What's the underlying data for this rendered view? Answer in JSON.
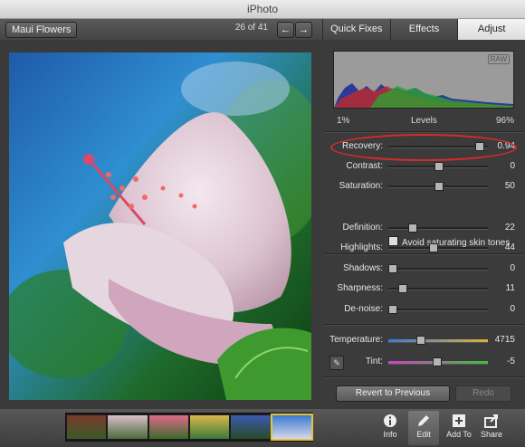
{
  "window": {
    "title": "iPhoto"
  },
  "toolbar": {
    "album_label": "Maui Flowers",
    "counter": "26 of 41",
    "prev_glyph": "←",
    "next_glyph": "→"
  },
  "tabs": [
    {
      "label": "Quick Fixes",
      "active": false
    },
    {
      "label": "Effects",
      "active": false
    },
    {
      "label": "Adjust",
      "active": true
    }
  ],
  "histogram": {
    "raw_badge": "RAW",
    "left_label": "1%",
    "center_label": "Levels",
    "right_label": "96%"
  },
  "sliders_exposure": [
    {
      "label": "Recovery:",
      "value": "0.94",
      "position": 0.94
    },
    {
      "label": "Contrast:",
      "value": "0",
      "position": 0.5
    },
    {
      "label": "Saturation:",
      "value": "50",
      "position": 0.5
    }
  ],
  "checkbox": {
    "label": "Avoid saturating skin tones",
    "checked": false
  },
  "sliders_detail": [
    {
      "label": "Definition:",
      "value": "22",
      "position": 0.22
    },
    {
      "label": "Highlights:",
      "value": "44",
      "position": 0.44
    },
    {
      "label": "Shadows:",
      "value": "0",
      "position": 0.0
    },
    {
      "label": "Sharpness:",
      "value": "11",
      "position": 0.11
    },
    {
      "label": "De-noise:",
      "value": "0",
      "position": 0.0
    }
  ],
  "sliders_color": [
    {
      "label": "Temperature:",
      "value": "4715",
      "position": 0.3
    },
    {
      "label": "Tint:",
      "value": "-5",
      "position": 0.48
    }
  ],
  "buttons": {
    "revert": "Revert to Previous",
    "redo": "Redo"
  },
  "bottom_tools": [
    {
      "label": "Info",
      "icon": "info-icon",
      "active": false
    },
    {
      "label": "Edit",
      "icon": "pencil-icon",
      "active": true
    },
    {
      "label": "Add To",
      "icon": "plus-icon",
      "active": false
    },
    {
      "label": "Share",
      "icon": "share-icon",
      "active": false
    }
  ],
  "colors": {
    "callout": "#d92a2a",
    "panel": "#3b3b3b",
    "toolbar": "#4a4a4a"
  }
}
